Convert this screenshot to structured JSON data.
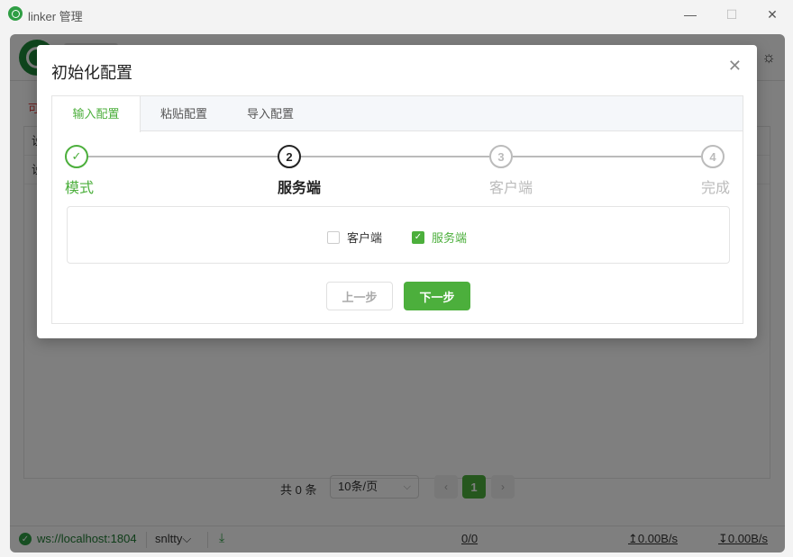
{
  "window": {
    "title": "linker 管理",
    "minimize": "—",
    "maximize": "☐",
    "close": "✕"
  },
  "app": {
    "red_note": "可",
    "table_rows": [
      "设",
      "设"
    ],
    "pagination": {
      "total": "共 0 条",
      "page_size": "10条/页",
      "current_page": "1",
      "prev": "‹",
      "next": "›"
    },
    "status": {
      "ws": "ws://localhost:1804",
      "host": "snltty",
      "host_caret": "⌵",
      "count": "0/0",
      "up": "↥0.00B/s",
      "down": "↧0.00B/s"
    }
  },
  "modal": {
    "title": "初始化配置",
    "close": "✕",
    "tabs": [
      {
        "label": "输入配置",
        "active": true
      },
      {
        "label": "粘贴配置",
        "active": false
      },
      {
        "label": "导入配置",
        "active": false
      }
    ],
    "steps": [
      {
        "label": "模式",
        "number": "✓",
        "state": "done"
      },
      {
        "label": "服务端",
        "number": "2",
        "state": "current"
      },
      {
        "label": "客户端",
        "number": "3",
        "state": "pending"
      },
      {
        "label": "完成",
        "number": "4",
        "state": "pending"
      }
    ],
    "options": {
      "client": "客户端",
      "client_checked": false,
      "server": "服务端",
      "server_checked": true
    },
    "prev_button": "上一步",
    "next_button": "下一步"
  },
  "colors": {
    "accent": "#4caf3c",
    "danger": "#e03e3e",
    "brand": "#1f8a3a"
  }
}
